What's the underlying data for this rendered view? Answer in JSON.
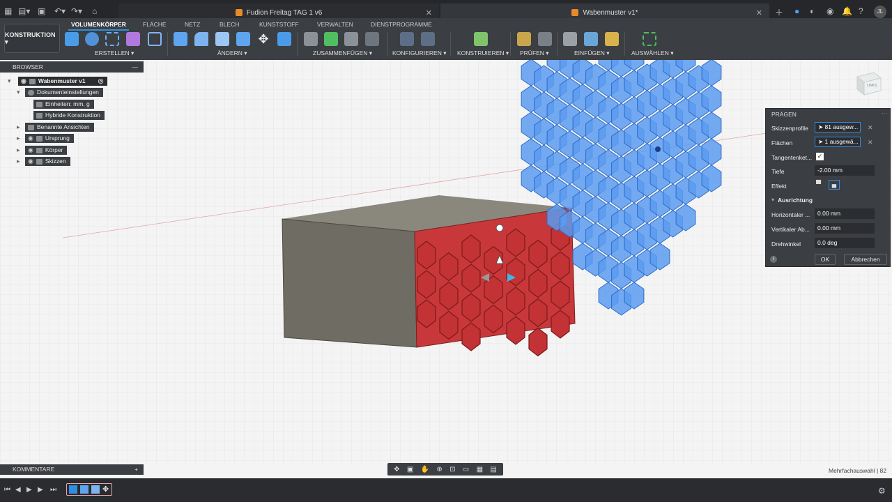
{
  "titlebar": {
    "tab1": "Fudion Freitag TAG 1 v6",
    "tab2": "Wabenmuster v1*",
    "user_initials": "JL"
  },
  "ribbon": {
    "workspace": "KONSTRUKTION ▾",
    "tabs": [
      "VOLUMENKÖRPER",
      "FLÄCHE",
      "NETZ",
      "BLECH",
      "KUNSTSTOFF",
      "VERWALTEN",
      "DIENSTPROGRAMME"
    ],
    "groups": [
      "ERSTELLEN ▾",
      "ÄNDERN ▾",
      "ZUSAMMENFÜGEN ▾",
      "KONFIGURIEREN ▾",
      "KONSTRUIEREN ▾",
      "PRÜFEN ▾",
      "EINFÜGEN ▾",
      "AUSWÄHLEN ▾"
    ]
  },
  "browser": {
    "header": "BROWSER",
    "items": [
      {
        "label": "Wabenmuster v1"
      },
      {
        "label": "Dokumenteinstellungen"
      },
      {
        "label": "Einheiten: mm, g"
      },
      {
        "label": "Hybride Konstruktion"
      },
      {
        "label": "Benannte Ansichten"
      },
      {
        "label": "Ursprung"
      },
      {
        "label": "Körper"
      },
      {
        "label": "Skizzen"
      }
    ]
  },
  "comments": {
    "header": "KOMMENTARE",
    "add": "+"
  },
  "statusbar": {
    "text": "Mehrfachauswahl | 82"
  },
  "dialog": {
    "title": "PRÄGEN",
    "skizzenprofile_label": "Skizzenprofile",
    "skizzenprofile_value": "81 ausgew...",
    "flaechen_label": "Flächen",
    "flaechen_value": "1 ausgewä...",
    "tangent_label": "Tangentenket...",
    "tangent_checked": true,
    "tiefe_label": "Tiefe",
    "tiefe_value": "-2.00 mm",
    "effekt_label": "Effekt",
    "ausrichtung_label": "Ausrichtung",
    "horizontal_label": "Horizontaler ...",
    "horizontal_value": "0.00 mm",
    "vertikal_label": "Vertikaler Ab...",
    "vertikal_value": "0.00 mm",
    "drehwinkel_label": "Drehwinkel",
    "drehwinkel_value": "0.0 deg",
    "ok": "OK",
    "cancel": "Abbrechen"
  },
  "viewcube": {
    "label": "LINKS"
  },
  "colors": {
    "accent": "#2f8de4",
    "hex_blue": "#5b9bf0",
    "hex_red": "#c8383a",
    "box": "#6f6c63"
  }
}
